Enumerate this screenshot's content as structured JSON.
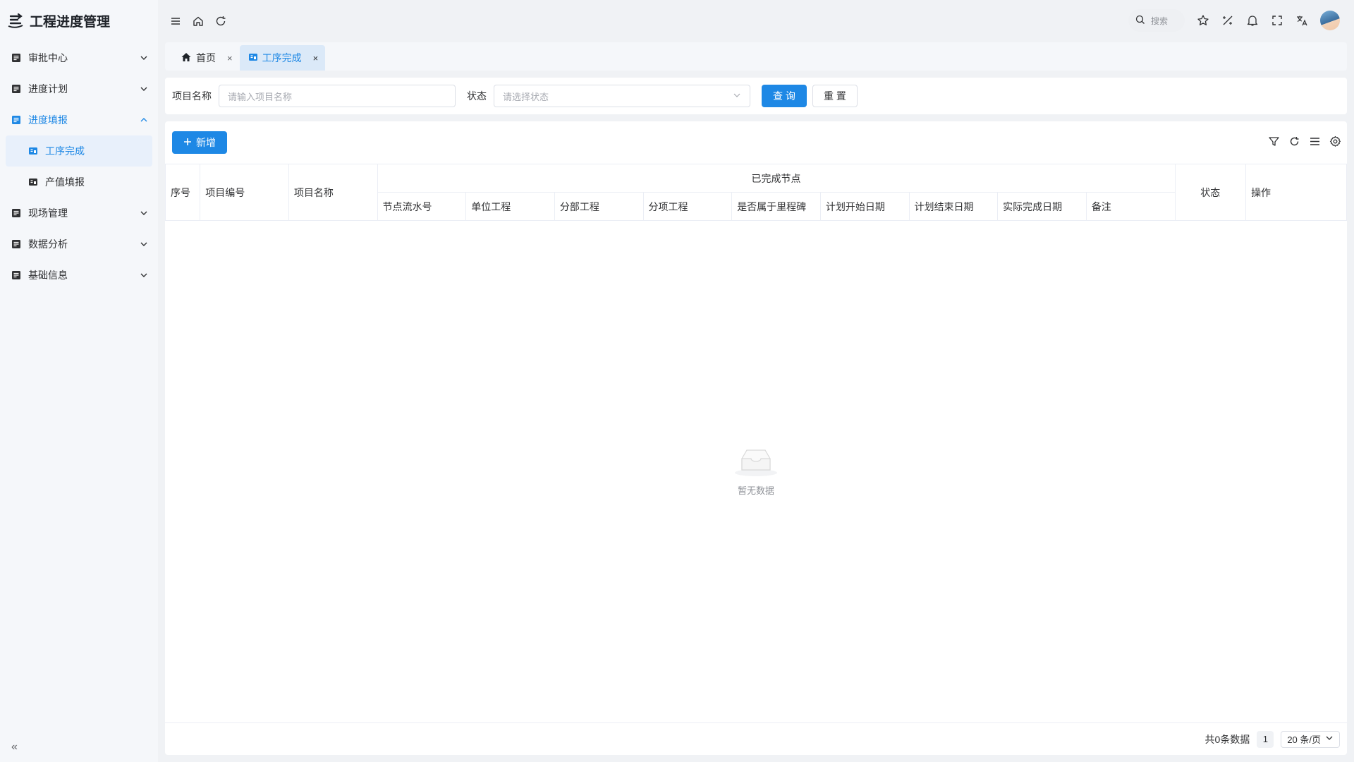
{
  "app": {
    "title": "工程进度管理"
  },
  "sidebar": {
    "items": [
      {
        "label": "审批中心"
      },
      {
        "label": "进度计划"
      },
      {
        "label": "进度填报",
        "children": [
          {
            "label": "工序完成"
          },
          {
            "label": "产值填报"
          }
        ]
      },
      {
        "label": "现场管理"
      },
      {
        "label": "数据分析"
      },
      {
        "label": "基础信息"
      }
    ],
    "collapse_label": "«"
  },
  "topbar": {
    "search_placeholder": "搜索"
  },
  "tabs": [
    {
      "label": "首页",
      "close": "×"
    },
    {
      "label": "工序完成",
      "close": "×"
    }
  ],
  "filters": {
    "project_name_label": "项目名称",
    "project_name_placeholder": "请输入项目名称",
    "status_label": "状态",
    "status_placeholder": "请选择状态",
    "query_label": "查 询",
    "reset_label": "重 置"
  },
  "toolbar": {
    "add_label": "新增"
  },
  "table": {
    "columns": {
      "seq": "序号",
      "project_code": "项目编号",
      "project_name": "项目名称",
      "completed_nodes": "已完成节点",
      "node_serial": "节点流水号",
      "unit_project": "单位工程",
      "division_project": "分部工程",
      "item_project": "分项工程",
      "is_milestone": "是否属于里程碑",
      "plan_start": "计划开始日期",
      "plan_end": "计划结束日期",
      "actual_finish": "实际完成日期",
      "remark": "备注",
      "status": "状态",
      "actions": "操作"
    },
    "rows": [],
    "empty_text": "暂无数据"
  },
  "pagination": {
    "total_text": "共0条数据",
    "current_page": "1",
    "page_size": "20 条/页"
  },
  "colors": {
    "accent": "#1e88e5"
  }
}
